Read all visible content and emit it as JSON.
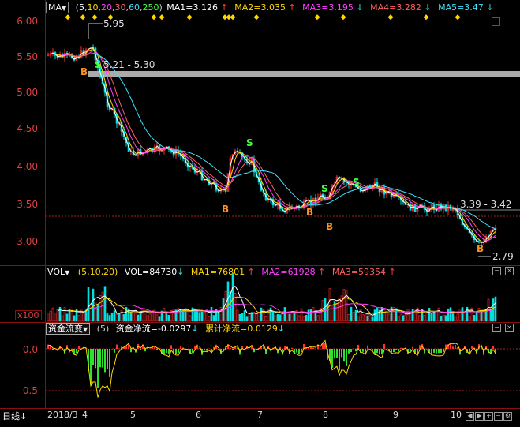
{
  "main": {
    "indicator": "MA",
    "params": [
      "5",
      "10",
      "20",
      "30",
      "60",
      "250"
    ],
    "ma": [
      {
        "label": "MA1=3.126",
        "arrow": "↑",
        "color": "#ffffff"
      },
      {
        "label": "MA2=3.035",
        "arrow": "↑",
        "color": "#ffd700"
      },
      {
        "label": "MA3=3.195",
        "arrow": "↓",
        "color": "#ff40ff"
      },
      {
        "label": "MA4=3.282",
        "arrow": "↓",
        "color": "#ff6060"
      },
      {
        "label": "MA5=3.47",
        "arrow": "↓",
        "color": "#40e0ff"
      }
    ],
    "ylabels": [
      "6.00",
      "5.50",
      "5.00",
      "4.50",
      "4.00",
      "3.50",
      "3.00"
    ],
    "annotations": {
      "high": "5.95",
      "range1": "5.21 - 5.30",
      "range2": "3.39 - 3.42",
      "low": "2.79",
      "buy": "B",
      "sell": "S"
    }
  },
  "vol": {
    "indicator": "VOL",
    "params": "(5,10,20)",
    "values": [
      {
        "label": "VOL=84730",
        "arrow": "↓",
        "color": "#ffffff"
      },
      {
        "label": "MA1=76801",
        "arrow": "↑",
        "color": "#ffd700"
      },
      {
        "label": "MA2=61928",
        "arrow": "↑",
        "color": "#ff40ff"
      },
      {
        "label": "MA3=59354",
        "arrow": "↑",
        "color": "#ff6060"
      }
    ],
    "unit": "x100"
  },
  "flow": {
    "indicator": "资金流变",
    "params": "(5)",
    "values": [
      {
        "label": "资金净流=-0.0297",
        "arrow": "↓",
        "color": "#ffffff"
      },
      {
        "label": "累计净流=0.0129",
        "arrow": "↓",
        "color": "#ffd700"
      }
    ],
    "ylabels": [
      "0.0",
      "-0.5"
    ]
  },
  "footer": {
    "period": "日线",
    "xlabels": [
      "2018/3",
      "4",
      "5",
      "6",
      "7",
      "8",
      "9",
      "10"
    ]
  },
  "icons": {
    "minimize": "−",
    "close": "×",
    "add": "+",
    "scroll_left": "◀",
    "scroll_right": "▶",
    "zoom_in": "+",
    "zoom_out": "−",
    "settings": "⚙"
  },
  "colors": {
    "up": "#ff3030",
    "down": "#00e0e0",
    "grid": "#8a1010",
    "axis_text": "#e04040"
  }
}
